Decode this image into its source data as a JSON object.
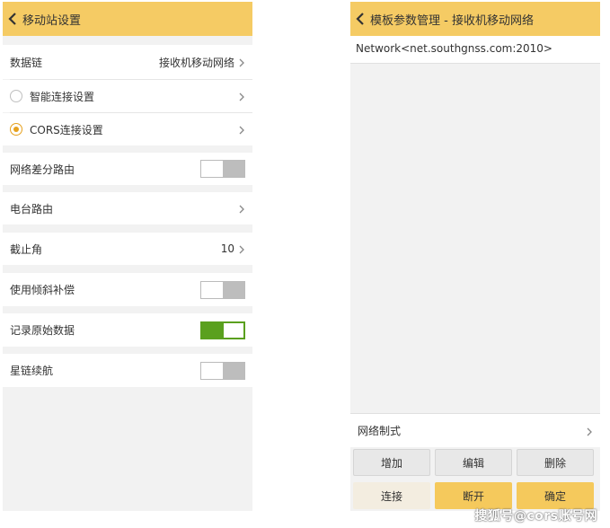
{
  "left": {
    "title": "移动站设置",
    "rows": {
      "data_link": {
        "label": "数据链",
        "value": "接收机移动网络"
      },
      "smart_connect": {
        "label": "智能连接设置"
      },
      "cors_connect": {
        "label": "CORS连接设置"
      },
      "network_diff_route": {
        "label": "网络差分路由",
        "enabled": false
      },
      "radio_route": {
        "label": "电台路由"
      },
      "cutoff_angle": {
        "label": "截止角",
        "value": "10"
      },
      "tilt_compensation": {
        "label": "使用倾斜补偿",
        "enabled": false
      },
      "record_raw": {
        "label": "记录原始数据",
        "enabled": true
      },
      "star_chain": {
        "label": "星链续航",
        "enabled": false
      }
    }
  },
  "right": {
    "title": "模板参数管理 - 接收机移动网络",
    "network_entry": "Network<net.southgnss.com:2010>",
    "network_mode_label": "网络制式",
    "buttons": {
      "add": "增加",
      "edit": "编辑",
      "delete": "删除",
      "connect": "连接",
      "disconnect": "断开",
      "confirm": "确定"
    }
  },
  "watermark": "搜狐号@cors账号网",
  "colors": {
    "title_bar": "#f5cb64",
    "toggle_on": "#5aa01e",
    "radio_selected": "#e6a11e",
    "button_gold": "#f5c95c"
  }
}
